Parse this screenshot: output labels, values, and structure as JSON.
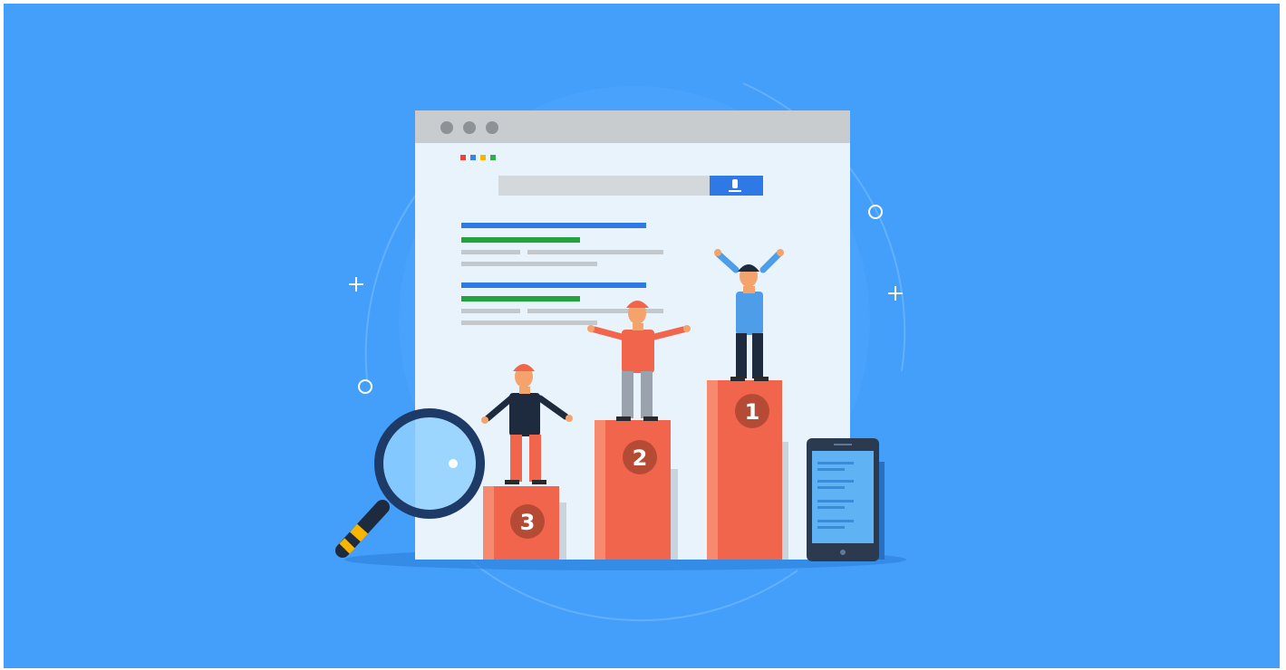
{
  "illustration": {
    "colors": {
      "background": "#449ffb",
      "browser_frame": "#c8cccf",
      "browser_body": "#e8f3fc",
      "accent_blue": "#2f79e6",
      "accent_green": "#24a33c",
      "podium": "#f2654d",
      "podium_badge": "#b54a35"
    },
    "google_dots": [
      "#e8453c",
      "#3d7ff0",
      "#f7b500",
      "#2fae4a"
    ],
    "search_button_icon": "microphone-icon",
    "podiums": [
      {
        "rank": "1",
        "person_shirt": "#4d9de8",
        "person_pants": "#1e2a3d"
      },
      {
        "rank": "2",
        "person_shirt": "#f2654d",
        "person_pants": "#9aa3ad"
      },
      {
        "rank": "3",
        "person_shirt": "#1e2a3d",
        "person_pants": "#f2654d"
      }
    ],
    "magnifier_icon": "magnifying-glass-icon",
    "phone_icon": "smartphone-icon"
  }
}
